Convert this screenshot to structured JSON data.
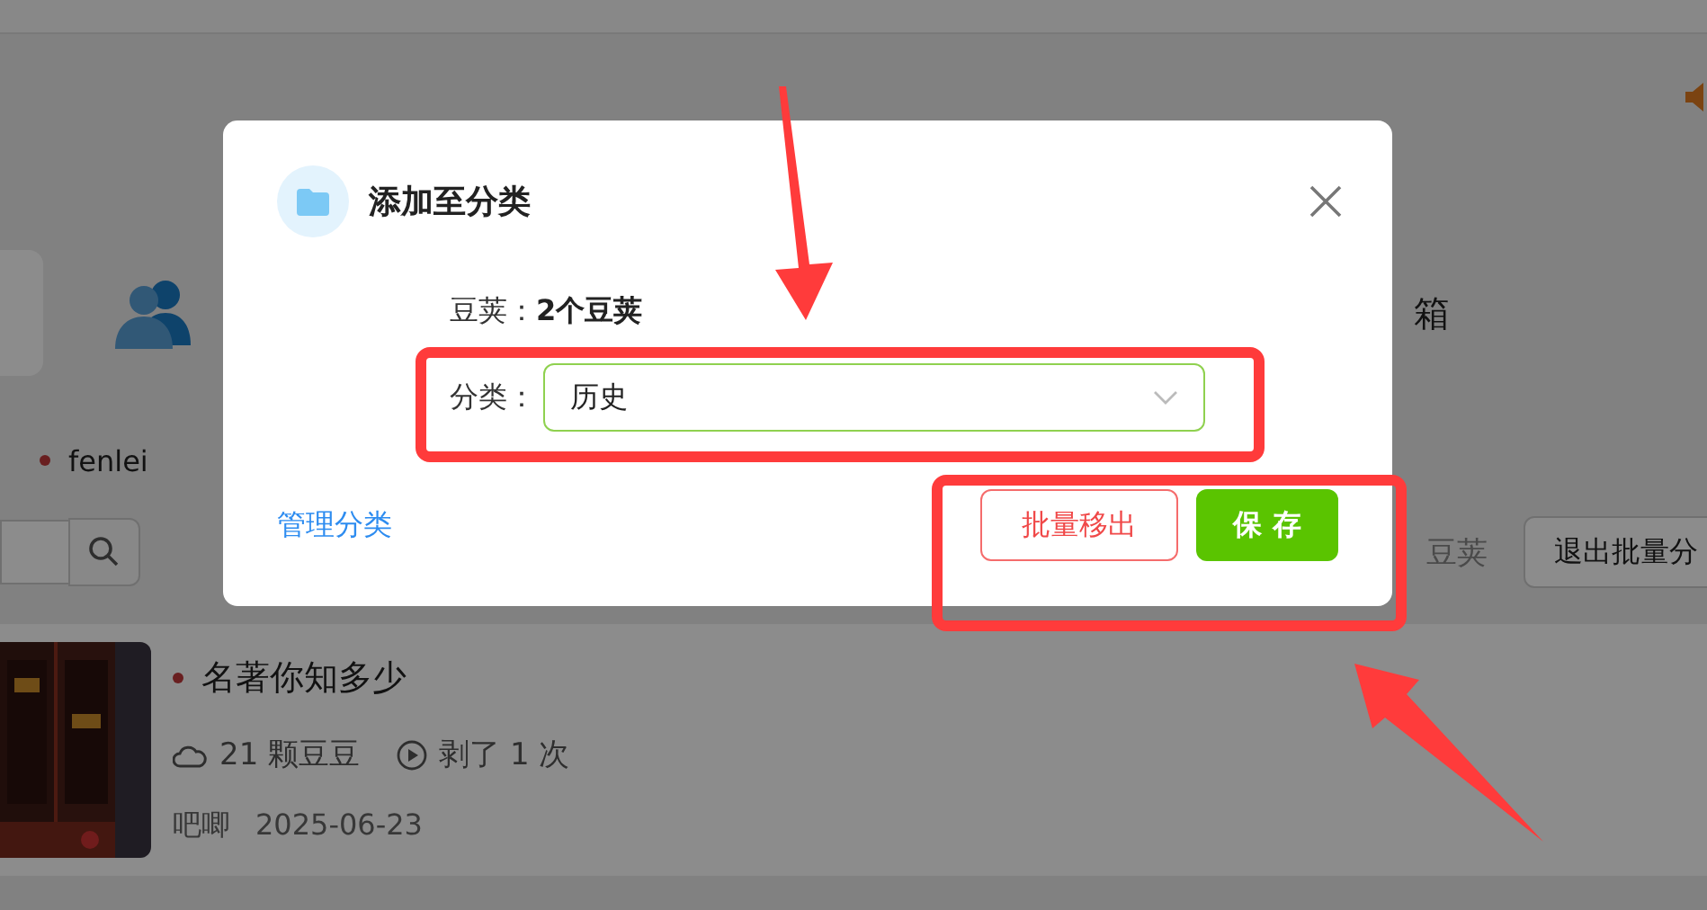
{
  "background": {
    "nav_items": [
      {
        "label": "箱"
      }
    ],
    "category_tag": {
      "label": "fenlei"
    },
    "count_text": "豆荚",
    "exit_button": "退出批量分",
    "item": {
      "title": "名著你知多少",
      "beans": "21 颗豆豆",
      "plays": "剥了 1 次",
      "author": "吧唧",
      "date": "2025-06-23"
    }
  },
  "dialog": {
    "title": "添加至分类",
    "pods_label": "豆荚：",
    "pods_value": "2个豆荚",
    "category_label": "分类：",
    "category_value": "历史",
    "manage_link": "管理分类",
    "remove_button": "批量移出",
    "save_button": "保 存"
  }
}
